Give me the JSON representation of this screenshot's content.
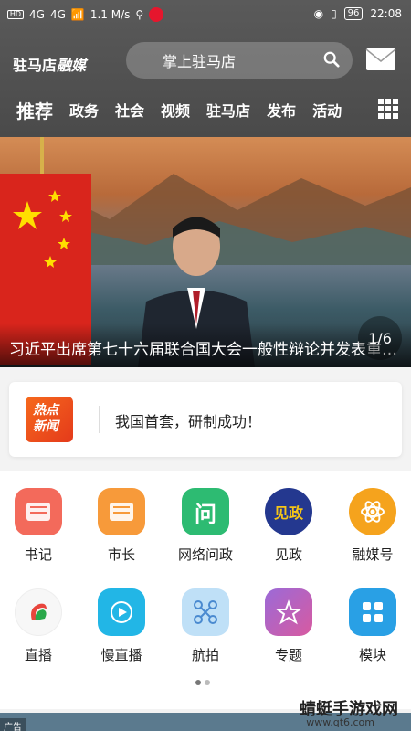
{
  "status": {
    "left_net1": "HD",
    "left_net2": "4G",
    "speed": "1.1 M/s",
    "battery": "96",
    "time": "22:08"
  },
  "header": {
    "logo_text": "驻马店",
    "logo_cal": "融媒",
    "search_placeholder": "掌上驻马店"
  },
  "tabs": [
    {
      "label": "推荐",
      "active": true
    },
    {
      "label": "政务"
    },
    {
      "label": "社会"
    },
    {
      "label": "视频"
    },
    {
      "label": "驻马店"
    },
    {
      "label": "发布"
    },
    {
      "label": "活动"
    }
  ],
  "banner": {
    "caption": "习近平出席第七十六届联合国大会一般性辩论并发表重要讲话",
    "counter": "1/6"
  },
  "hot": {
    "badge_line1": "热点",
    "badge_line2": "新闻",
    "text": "我国首套，研制成功！"
  },
  "grid": {
    "row1": [
      {
        "label": "书记",
        "icon": "book-video-icon",
        "color": "#f36a5b"
      },
      {
        "label": "市长",
        "icon": "mayor-video-icon",
        "color": "#f79a3a"
      },
      {
        "label": "网络问政",
        "icon": "question-icon",
        "color": "#2dbb72"
      },
      {
        "label": "见政",
        "icon": "jianzheng-icon",
        "color": "#24388f"
      },
      {
        "label": "融媒号",
        "icon": "atom-icon",
        "color": "#f5a31d"
      }
    ],
    "row2": [
      {
        "label": "直播",
        "icon": "live-icon",
        "color": "#ffffff"
      },
      {
        "label": "慢直播",
        "icon": "play-icon",
        "color": "#22b6e6"
      },
      {
        "label": "航拍",
        "icon": "drone-icon",
        "color": "#bfe0f7"
      },
      {
        "label": "专题",
        "icon": "star-icon",
        "color": "#9b6ad8"
      },
      {
        "label": "模块",
        "icon": "modules-icon",
        "color": "#29a0e5"
      }
    ]
  },
  "ad": {
    "label": "广告"
  },
  "watermark": {
    "main": "蜻蜓手游戏网",
    "sub": "www.qt6.com"
  }
}
